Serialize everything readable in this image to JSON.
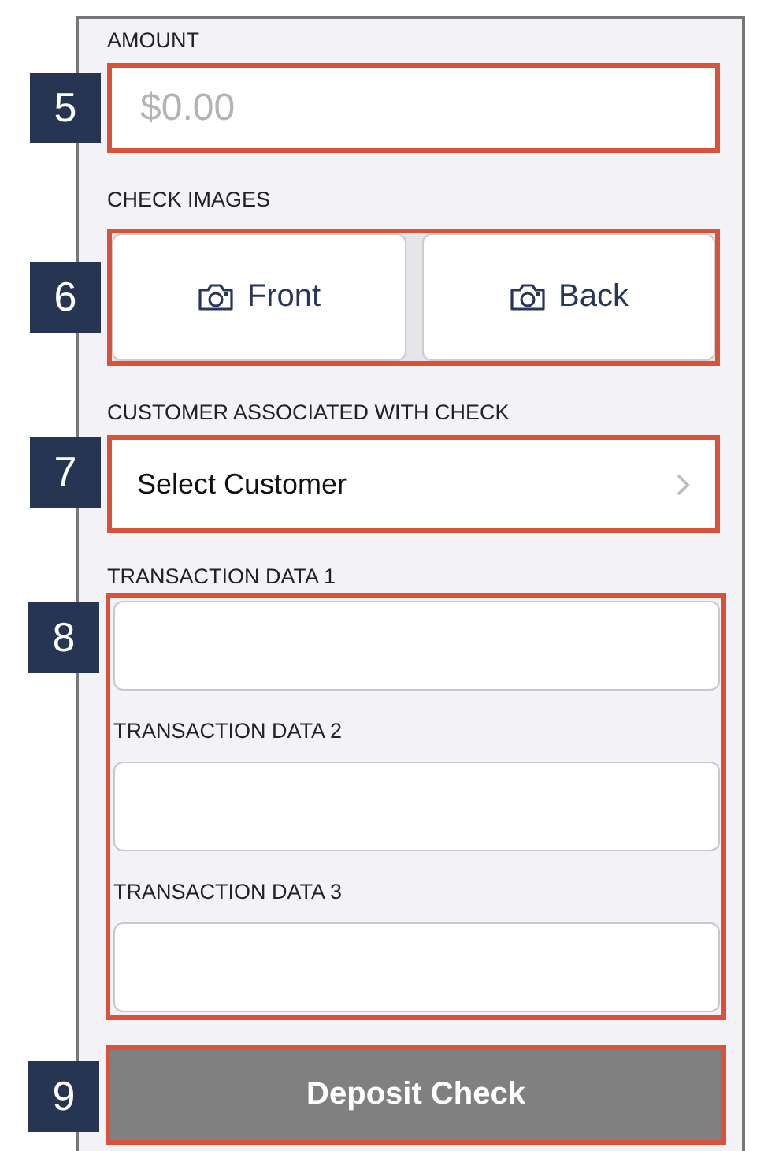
{
  "amount": {
    "label": "AMOUNT",
    "callout": "5",
    "placeholder": "$0.00"
  },
  "check_images": {
    "label": "CHECK IMAGES",
    "callout": "6",
    "buttons": [
      "Front",
      "Back"
    ]
  },
  "customer": {
    "label": "CUSTOMER ASSOCIATED WITH CHECK",
    "callout": "7",
    "value": "Select Customer"
  },
  "transaction_data": {
    "callout": "8",
    "fields": [
      {
        "label": "TRANSACTION DATA 1"
      },
      {
        "label": "TRANSACTION DATA 2"
      },
      {
        "label": "TRANSACTION DATA 3"
      }
    ]
  },
  "deposit_button": {
    "label": "Deposit Check",
    "callout": "9"
  }
}
